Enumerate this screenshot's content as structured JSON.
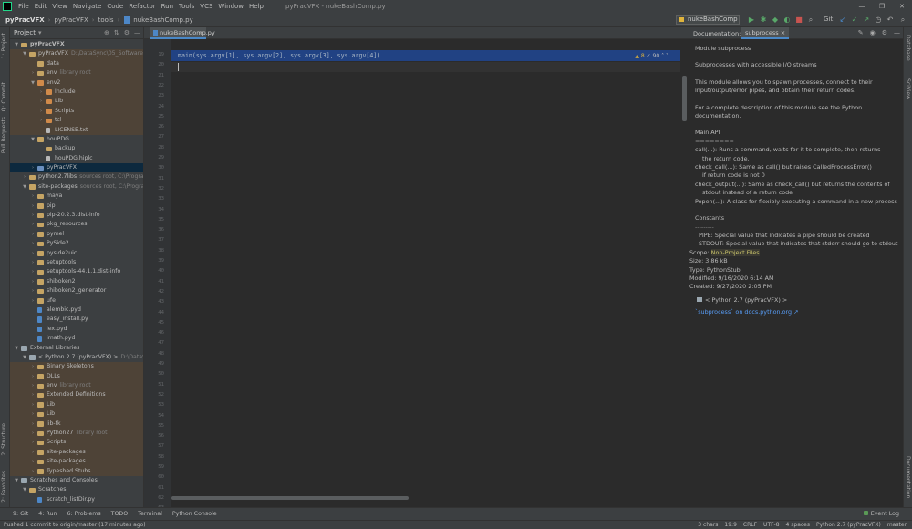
{
  "menubar": {
    "items": [
      "File",
      "Edit",
      "View",
      "Navigate",
      "Code",
      "Refactor",
      "Run",
      "Tools",
      "VCS",
      "Window",
      "Help"
    ],
    "window_title": "pyPracVFX - nukeBashComp.py",
    "controls": [
      "—",
      "❐",
      "✕"
    ]
  },
  "navbar": {
    "crumbs": [
      "pyPracVFX",
      "pyPracVFX",
      "tools",
      "nukeBashComp.py"
    ],
    "run_config": "nukeBashComp",
    "git_label": "Git:"
  },
  "left_strip": {
    "labels": [
      "1: Project",
      "Q: Commit",
      "Pull Requests",
      "2: Structure",
      "2: Favorites"
    ]
  },
  "project": {
    "header": "Project",
    "rows": [
      {
        "depth": 0,
        "arrow": "▼",
        "icon": "folder",
        "label": "pyPracVFX",
        "sub": "",
        "style": "",
        "bold": true
      },
      {
        "depth": 1,
        "arrow": "▼",
        "icon": "folder",
        "label": "pyPracVFX",
        "sub": "D:\\DataSync\\05_Software\\Pyt",
        "style": "excl"
      },
      {
        "depth": 2,
        "arrow": "",
        "icon": "folder",
        "label": "data",
        "sub": "",
        "style": "excl"
      },
      {
        "depth": 2,
        "arrow": "›",
        "icon": "folder",
        "label": "env",
        "sub": "library root",
        "style": "excl"
      },
      {
        "depth": 2,
        "arrow": "▼",
        "icon": "orange",
        "label": "env2",
        "sub": "",
        "style": "excl"
      },
      {
        "depth": 3,
        "arrow": "›",
        "icon": "orange",
        "label": "Include",
        "sub": "",
        "style": "excl"
      },
      {
        "depth": 3,
        "arrow": "›",
        "icon": "orange",
        "label": "Lib",
        "sub": "",
        "style": "excl"
      },
      {
        "depth": 3,
        "arrow": "›",
        "icon": "orange",
        "label": "Scripts",
        "sub": "",
        "style": "excl"
      },
      {
        "depth": 3,
        "arrow": "›",
        "icon": "orange",
        "label": "tcl",
        "sub": "",
        "style": "excl"
      },
      {
        "depth": 3,
        "arrow": "",
        "icon": "file",
        "label": "LICENSE.txt",
        "sub": "",
        "style": "excl"
      },
      {
        "depth": 2,
        "arrow": "▼",
        "icon": "folder",
        "label": "houPDG",
        "sub": "",
        "style": ""
      },
      {
        "depth": 3,
        "arrow": "",
        "icon": "folder",
        "label": "backup",
        "sub": "",
        "style": ""
      },
      {
        "depth": 3,
        "arrow": "",
        "icon": "file",
        "label": "houPDG.hiplc",
        "sub": "",
        "style": ""
      },
      {
        "depth": 2,
        "arrow": "›",
        "icon": "blue",
        "label": "pyPracVFX",
        "sub": "",
        "style": "sel"
      },
      {
        "depth": 1,
        "arrow": "›",
        "icon": "folder",
        "label": "python2.7libs",
        "sub": "sources root, C:\\Program Fi",
        "style": ""
      },
      {
        "depth": 1,
        "arrow": "▼",
        "icon": "folder",
        "label": "site-packages",
        "sub": "sources root, C:\\Program F",
        "style": ""
      },
      {
        "depth": 2,
        "arrow": "›",
        "icon": "folder",
        "label": "maya",
        "sub": "",
        "style": ""
      },
      {
        "depth": 2,
        "arrow": "›",
        "icon": "folder",
        "label": "pip",
        "sub": "",
        "style": ""
      },
      {
        "depth": 2,
        "arrow": "›",
        "icon": "folder",
        "label": "pip-20.2.3.dist-info",
        "sub": "",
        "style": ""
      },
      {
        "depth": 2,
        "arrow": "›",
        "icon": "folder",
        "label": "pkg_resources",
        "sub": "",
        "style": ""
      },
      {
        "depth": 2,
        "arrow": "›",
        "icon": "folder",
        "label": "pymel",
        "sub": "",
        "style": ""
      },
      {
        "depth": 2,
        "arrow": "›",
        "icon": "folder",
        "label": "PySide2",
        "sub": "",
        "style": ""
      },
      {
        "depth": 2,
        "arrow": "›",
        "icon": "folder",
        "label": "pyside2uic",
        "sub": "",
        "style": ""
      },
      {
        "depth": 2,
        "arrow": "›",
        "icon": "folder",
        "label": "setuptools",
        "sub": "",
        "style": ""
      },
      {
        "depth": 2,
        "arrow": "›",
        "icon": "folder",
        "label": "setuptools-44.1.1.dist-info",
        "sub": "",
        "style": ""
      },
      {
        "depth": 2,
        "arrow": "›",
        "icon": "folder",
        "label": "shiboken2",
        "sub": "",
        "style": ""
      },
      {
        "depth": 2,
        "arrow": "›",
        "icon": "folder",
        "label": "shiboken2_generator",
        "sub": "",
        "style": ""
      },
      {
        "depth": 2,
        "arrow": "›",
        "icon": "folder",
        "label": "ufe",
        "sub": "",
        "style": ""
      },
      {
        "depth": 2,
        "arrow": "",
        "icon": "py",
        "label": "alembic.pyd",
        "sub": "",
        "style": ""
      },
      {
        "depth": 2,
        "arrow": "",
        "icon": "py",
        "label": "easy_install.py",
        "sub": "",
        "style": ""
      },
      {
        "depth": 2,
        "arrow": "",
        "icon": "py",
        "label": "iex.pyd",
        "sub": "",
        "style": ""
      },
      {
        "depth": 2,
        "arrow": "",
        "icon": "py",
        "label": "imath.pyd",
        "sub": "",
        "style": ""
      },
      {
        "depth": 0,
        "arrow": "▼",
        "icon": "lib",
        "label": "External Libraries",
        "sub": "",
        "style": ""
      },
      {
        "depth": 1,
        "arrow": "▼",
        "icon": "lib",
        "label": "< Python 2.7 (pyPracVFX) >",
        "sub": "D:\\DataSync\\",
        "style": ""
      },
      {
        "depth": 2,
        "arrow": "›",
        "icon": "folder",
        "label": "Binary Skeletons",
        "sub": "",
        "style": "excl"
      },
      {
        "depth": 2,
        "arrow": "›",
        "icon": "folder",
        "label": "DLLs",
        "sub": "",
        "style": "excl"
      },
      {
        "depth": 2,
        "arrow": "›",
        "icon": "folder",
        "label": "env",
        "sub": "library root",
        "style": "excl"
      },
      {
        "depth": 2,
        "arrow": "›",
        "icon": "folder",
        "label": "Extended Definitions",
        "sub": "",
        "style": "excl"
      },
      {
        "depth": 2,
        "arrow": "›",
        "icon": "folder",
        "label": "Lib",
        "sub": "",
        "style": "excl"
      },
      {
        "depth": 2,
        "arrow": "›",
        "icon": "folder",
        "label": "Lib",
        "sub": "",
        "style": "excl"
      },
      {
        "depth": 2,
        "arrow": "›",
        "icon": "folder",
        "label": "lib-tk",
        "sub": "",
        "style": "excl"
      },
      {
        "depth": 2,
        "arrow": "›",
        "icon": "folder",
        "label": "Python27",
        "sub": "library root",
        "style": "excl"
      },
      {
        "depth": 2,
        "arrow": "›",
        "icon": "folder",
        "label": "Scripts",
        "sub": "",
        "style": "excl"
      },
      {
        "depth": 2,
        "arrow": "›",
        "icon": "folder",
        "label": "site-packages",
        "sub": "",
        "style": "excl"
      },
      {
        "depth": 2,
        "arrow": "›",
        "icon": "folder",
        "label": "site-packages",
        "sub": "",
        "style": "excl"
      },
      {
        "depth": 2,
        "arrow": "›",
        "icon": "folder",
        "label": "Typeshed Stubs",
        "sub": "",
        "style": "excl"
      },
      {
        "depth": 0,
        "arrow": "▼",
        "icon": "lib",
        "label": "Scratches and Consoles",
        "sub": "",
        "style": ""
      },
      {
        "depth": 1,
        "arrow": "▼",
        "icon": "folder",
        "label": "Scratches",
        "sub": "",
        "style": ""
      },
      {
        "depth": 2,
        "arrow": "",
        "icon": "py",
        "label": "scratch_listDir.py",
        "sub": "",
        "style": ""
      }
    ]
  },
  "editor": {
    "tab_label": "nukeBashComp.py",
    "line_numbers": [
      "19",
      "20",
      "21",
      "22",
      "23",
      "24",
      "25",
      "26",
      "27",
      "28",
      "29",
      "30",
      "31",
      "32",
      "33",
      "34",
      "35",
      "36",
      "37",
      "38",
      "39",
      "40",
      "41",
      "42",
      "43",
      "44",
      "45",
      "46",
      "47",
      "48",
      "49",
      "50",
      "51",
      "52",
      "53",
      "54",
      "55",
      "56",
      "57",
      "58",
      "59",
      "60",
      "61",
      "62",
      "63"
    ],
    "code_line": "main(sys.argv[1], sys.argv[2], sys.argv[3], sys.argv[4])",
    "warnings": "▲ 8",
    "weak_warnings": "✓ 90"
  },
  "documentation": {
    "title": "Documentation:",
    "tab": "subprocess",
    "module_heading": "Module subprocess",
    "summary": "Subprocesses with accessible I/O streams",
    "p1": "This module allows you to spawn processes, connect to their input/output/error pipes, and obtain their return codes.",
    "p2": "For a complete description of this module see the Python documentation.",
    "main_api_title": "Main API",
    "main_api_rule": "========",
    "api_lines": [
      {
        "text": "call(...): Runs a command, waits for it to complete, then returns",
        "indent": false
      },
      {
        "text": "the return code.",
        "indent": true
      },
      {
        "text": "check_call(...): Same as call() but raises CalledProcessError()",
        "indent": false
      },
      {
        "text": "if return code is not 0",
        "indent": true
      },
      {
        "text": "check_output(...): Same as check_call() but returns the contents of",
        "indent": false
      },
      {
        "text": "stdout instead of a return code",
        "indent": true
      },
      {
        "text": "Popen(...): A class for flexibly executing a command in a new process",
        "indent": false
      }
    ],
    "constants_title": "Constants",
    "constants_rule": "---------",
    "const_lines": [
      "PIPE:    Special value that indicates a pipe should be created",
      "STDOUT:  Special value that indicates that stderr should go to stdout"
    ],
    "scope_label": "Scope:",
    "scope_value": "Non-Project Files",
    "size": "Size: 3.86 kB",
    "type": "Type: PythonStub",
    "modified": "Modified: 9/16/2020 6:14 AM",
    "created": "Created: 9/27/2020 2:05 PM",
    "library": "< Python 2.7 (pyPracVFX) >",
    "link": "`subprocess` on docs.python.org ↗"
  },
  "right_strip": {
    "labels": [
      "Database",
      "SciView",
      "Documentation"
    ]
  },
  "bottombar": {
    "tools": [
      "9: Git",
      "4: Run",
      "6: Problems",
      "TODO",
      "Terminal",
      "Python Console"
    ],
    "event_log": "Event Log"
  },
  "statusbar": {
    "message": "Pushed 1 commit to origin/master (17 minutes ago)",
    "items": [
      "3 chars",
      "19:9",
      "CRLF",
      "UTF-8",
      "4 spaces",
      "Python 2.7 (pyPracVFX)",
      "master"
    ]
  },
  "colors": {
    "accent": "#4a88c7",
    "selection": "#214283",
    "excluded_bg": "#4e4337"
  }
}
